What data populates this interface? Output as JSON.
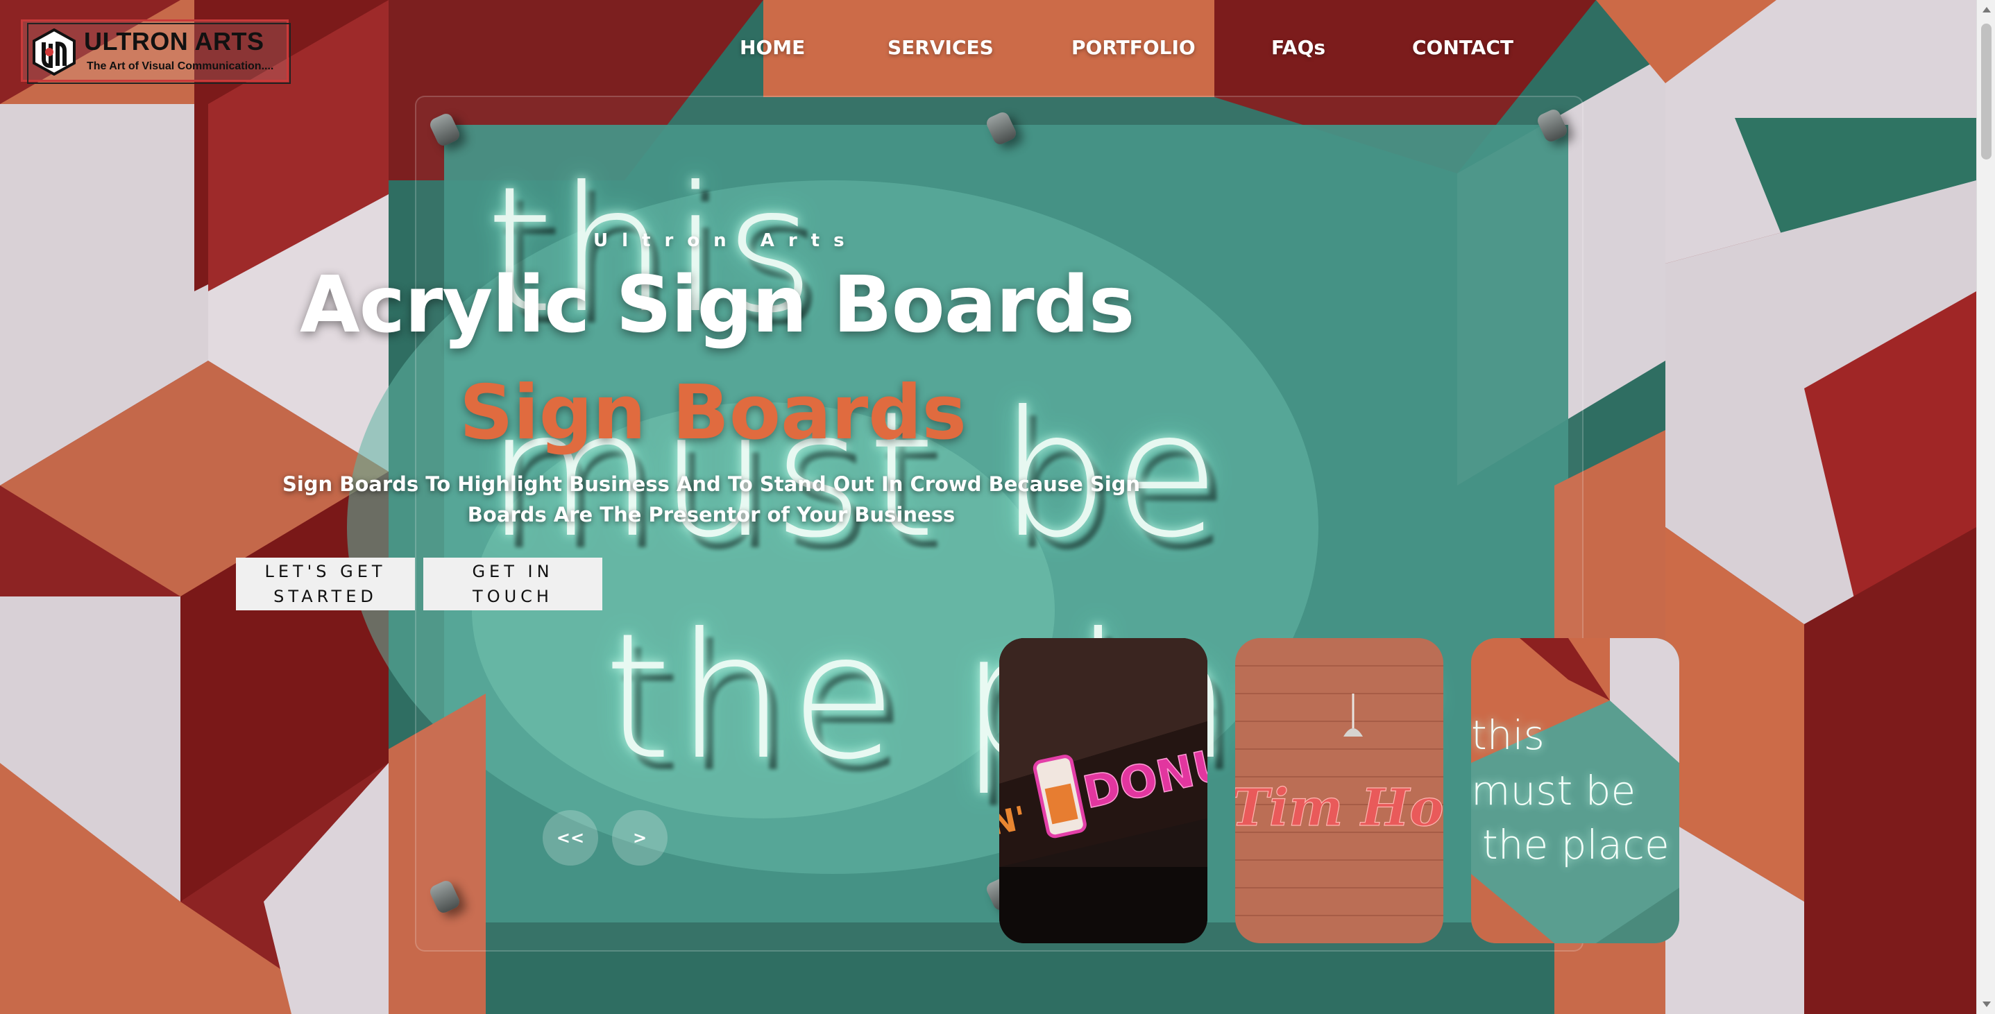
{
  "brand": {
    "name": "ULTRON ARTS",
    "tagline": "The Art of Visual Communication....",
    "colors": {
      "accent": "#e06b3f",
      "logo_border": "#c83a3a"
    }
  },
  "nav": {
    "items": [
      {
        "label": "HOME"
      },
      {
        "label": "SERVICES"
      },
      {
        "label": "PORTFOLIO"
      },
      {
        "label": "FAQs"
      },
      {
        "label": "CONTACT"
      }
    ]
  },
  "hero": {
    "eyebrow": "Ultron Arts",
    "headline": "Acrylic Sign Boards",
    "subline": "Sign Boards",
    "description": "Sign Boards To Highlight Business And To Stand Out In Crowd Because Sign Boards Are The Presentor of Your Business",
    "buttons": {
      "primary": "LET'S GET STARTED",
      "secondary": "GET IN TOUCH"
    },
    "background_neon_text": [
      "this",
      "must be",
      "the place"
    ]
  },
  "slider": {
    "prev_label": "<<",
    "next_label": ">",
    "cards": [
      {
        "text": "DONUTS",
        "icon": "donut-cup-icon"
      },
      {
        "text": "Tim Horto",
        "icon": "wall-lamp-icon"
      },
      {
        "text_lines": [
          "this",
          "must be",
          "the place"
        ]
      }
    ]
  }
}
